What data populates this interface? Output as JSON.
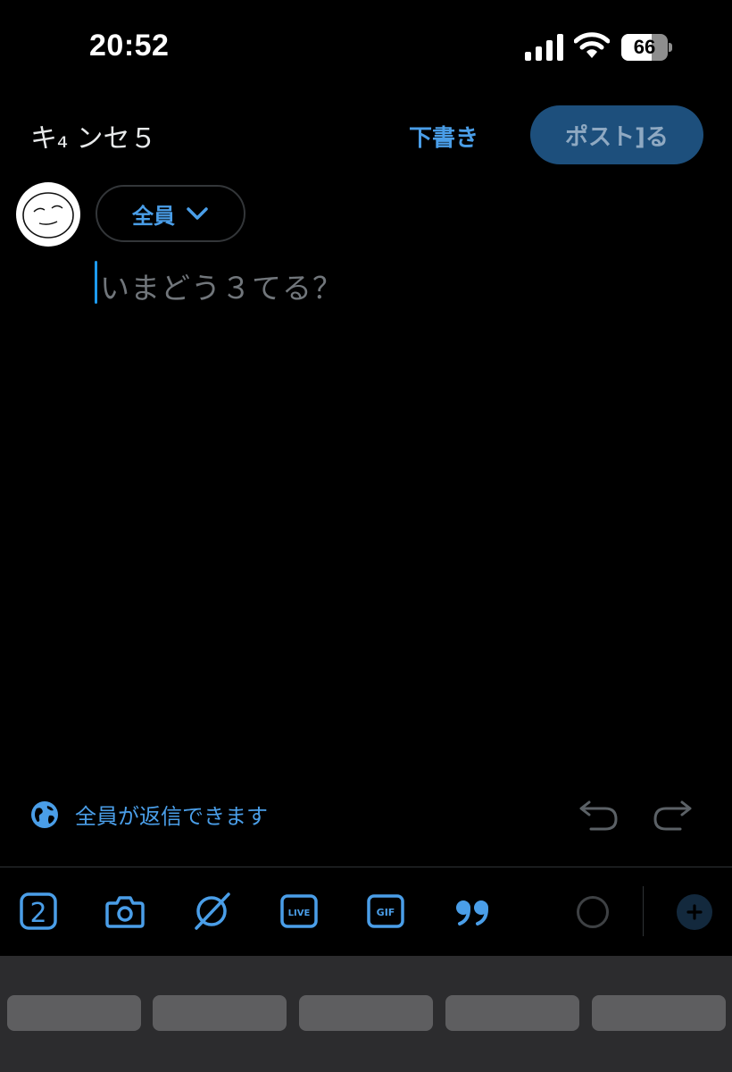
{
  "status_bar": {
    "time": "20:52",
    "battery_level": 66,
    "icons": [
      "signal-icon",
      "wifi-icon",
      "battery-icon"
    ]
  },
  "header": {
    "cancel_label": "キ₄ ンセ５",
    "drafts_label": "下書き",
    "post_label": "ポスト]る"
  },
  "composer": {
    "audience_label": "全員",
    "placeholder": "いまどう３てる？",
    "reply_setting_label": "全員が返信できます"
  },
  "toolbar": {
    "items": [
      "grok-icon",
      "camera-icon",
      "no-media-icon",
      "live-icon",
      "gif-icon",
      "quote-icon"
    ],
    "live_text": "LIVE",
    "gif_text": "GIF",
    "grok_text": "2"
  },
  "colors": {
    "accent": "#4a9ee8",
    "post_button_bg": "#1d4f7c",
    "background": "#000000",
    "keyboard_bg": "#2c2c2e"
  }
}
